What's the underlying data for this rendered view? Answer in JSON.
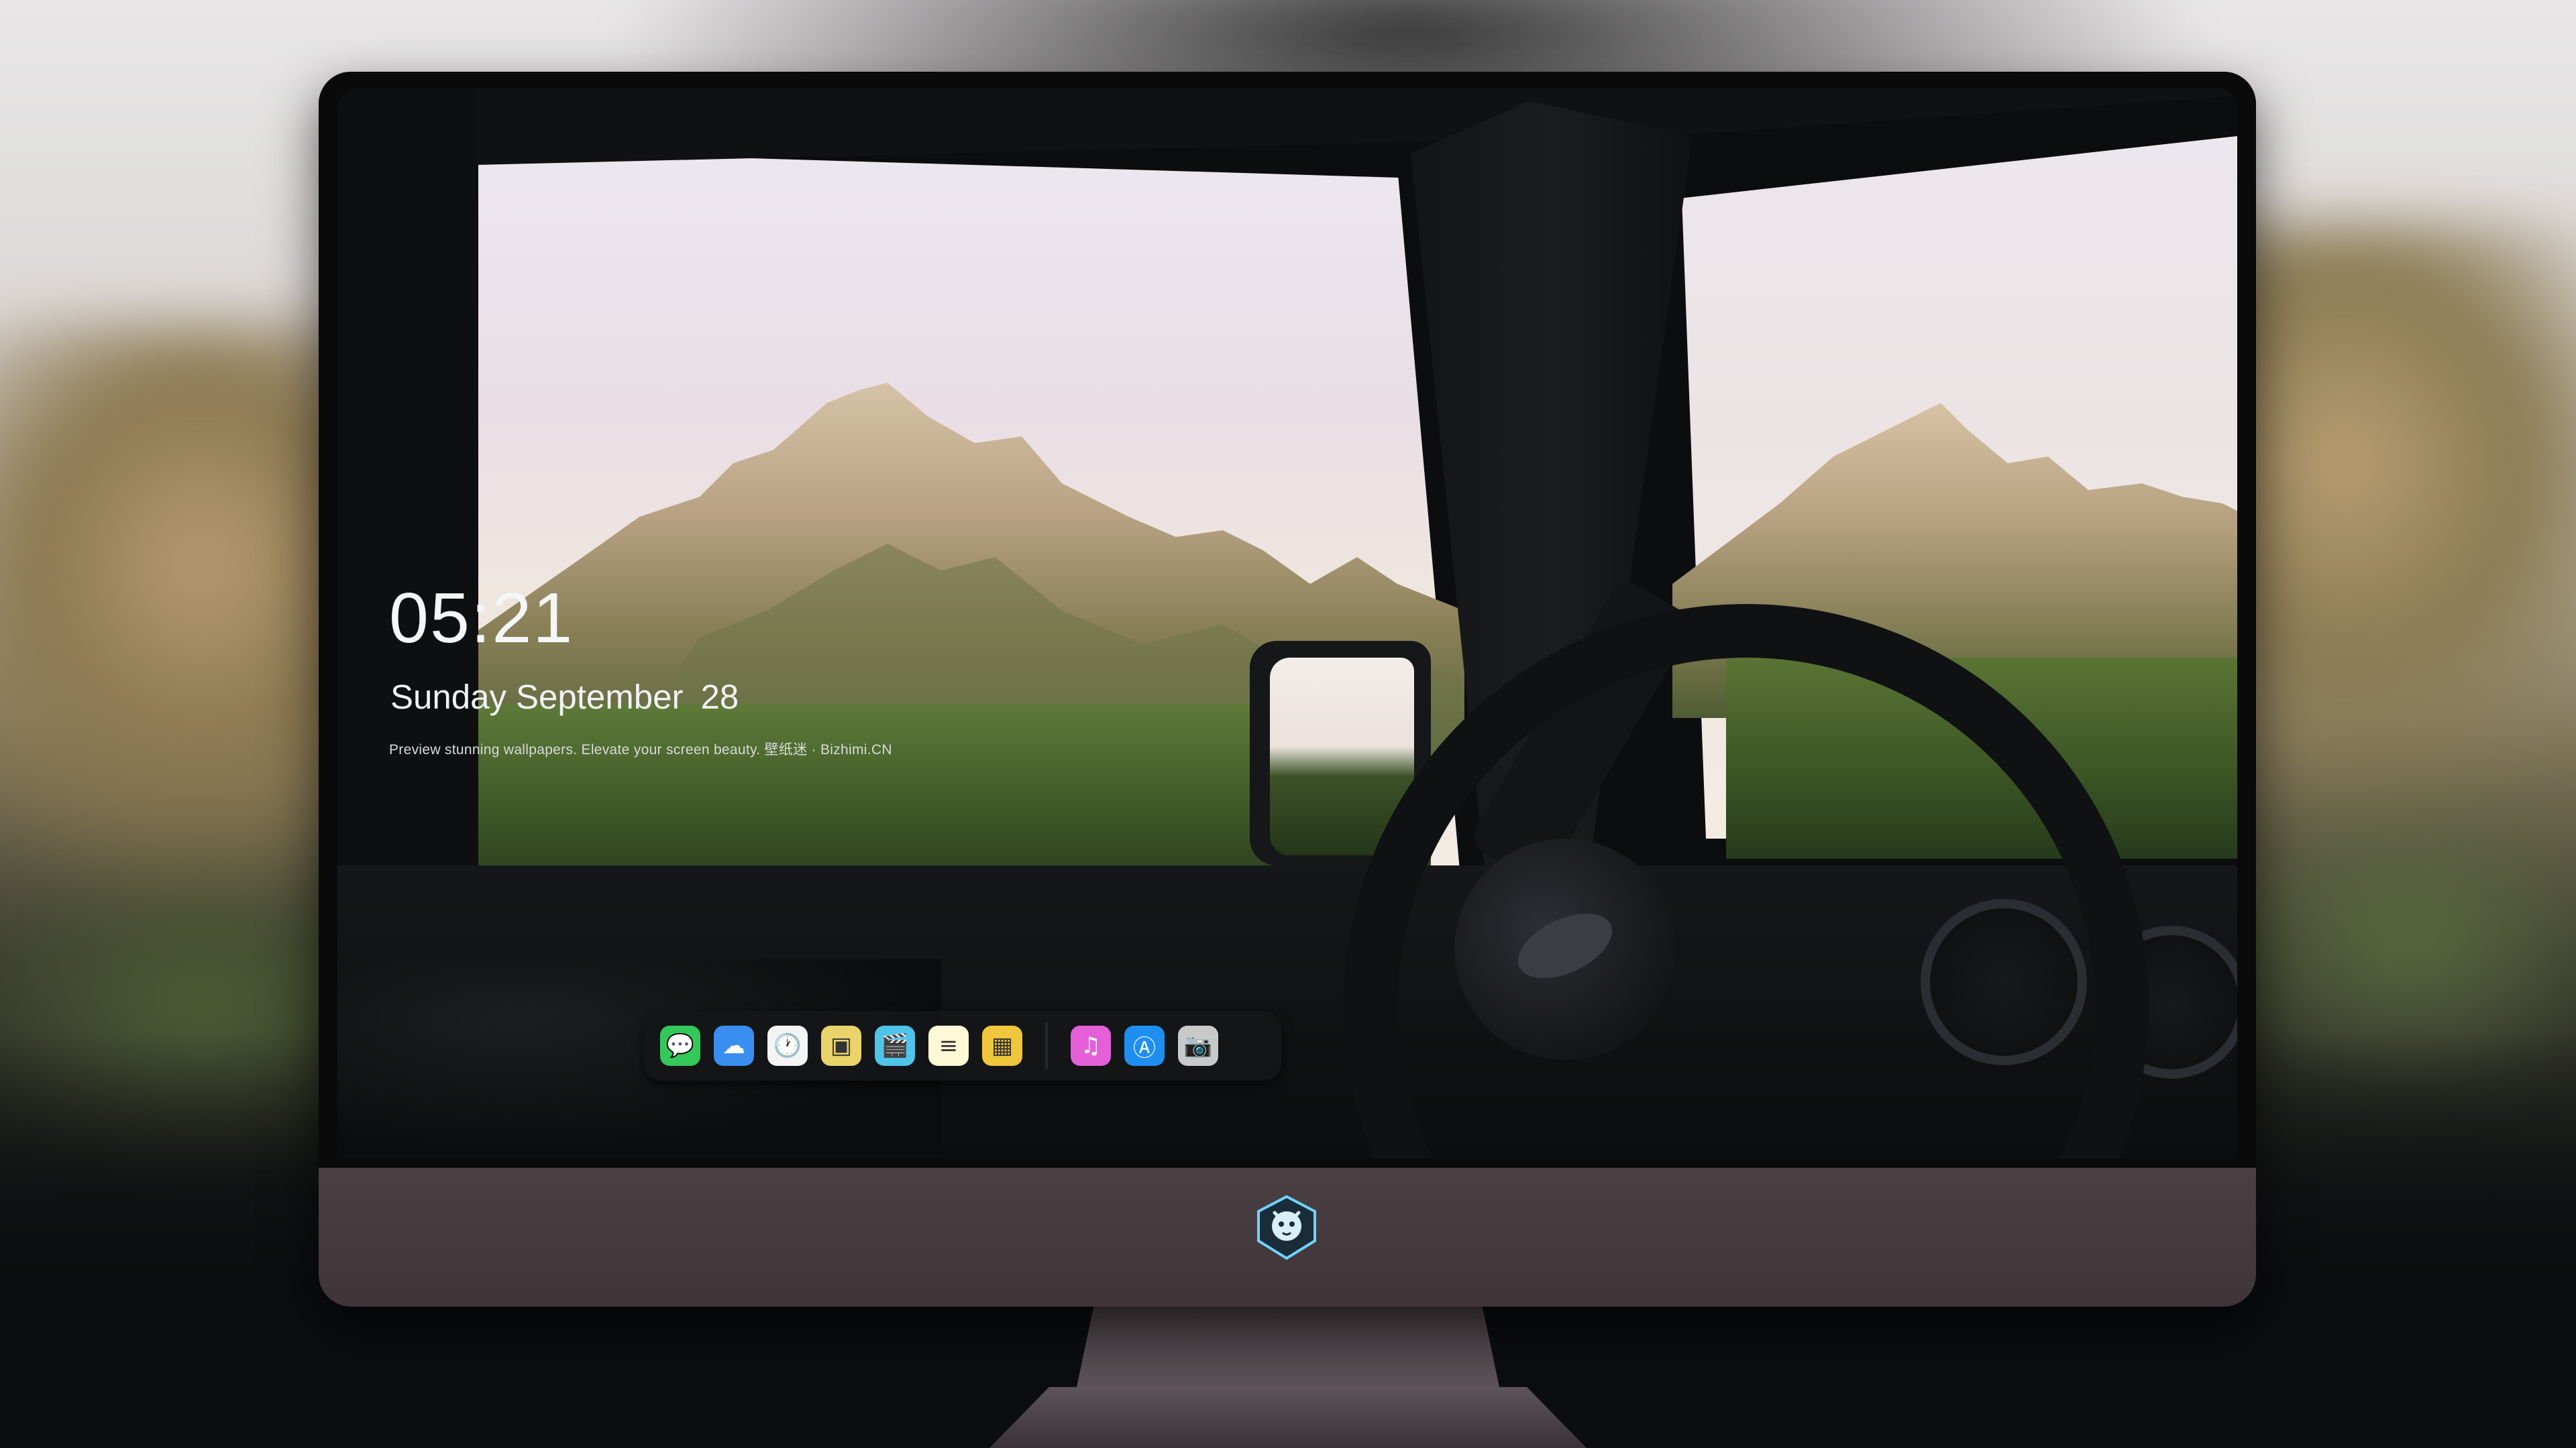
{
  "lockscreen": {
    "time": "05:21",
    "date_day": "Sunday",
    "date_month": "September",
    "date_num": "28",
    "caption": "Preview stunning wallpapers. Elevate your screen beauty. 壁纸迷 · Bizhimi.CN"
  },
  "dock": {
    "apps": [
      {
        "name": "Messages",
        "icon": "messages-icon",
        "glyph": "💬",
        "color": "#34c759"
      },
      {
        "name": "Weather",
        "icon": "weather-icon",
        "glyph": "☁",
        "color": "#3a8ef0"
      },
      {
        "name": "Clock",
        "icon": "clock-icon",
        "glyph": "🕐",
        "color": "#f4f4f4"
      },
      {
        "name": "Preview",
        "icon": "preview-icon",
        "glyph": "▣",
        "color": "#e9d36a"
      },
      {
        "name": "Clips",
        "icon": "clips-icon",
        "glyph": "🎬",
        "color": "#4fc3e8"
      },
      {
        "name": "Notes",
        "icon": "notes-icon",
        "glyph": "≡",
        "color": "#fff8d6"
      },
      {
        "name": "Photo Booth",
        "icon": "photo-booth-icon",
        "glyph": "▦",
        "color": "#f0c63c"
      },
      {
        "name": "iTunes",
        "icon": "itunes-icon",
        "glyph": "♫",
        "color": "#e45fd8"
      },
      {
        "name": "App Store",
        "icon": "app-store-icon",
        "glyph": "Ⓐ",
        "color": "#1f8ef1"
      },
      {
        "name": "Screenshot",
        "icon": "camera-icon",
        "glyph": "📷",
        "color": "#c9c9c9"
      }
    ]
  },
  "colors": {
    "monitor_chin": "#3f3538",
    "dock_bg": "#141618"
  }
}
